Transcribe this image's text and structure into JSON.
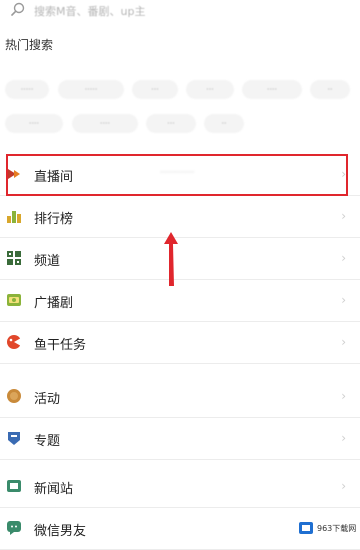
{
  "search": {
    "placeholder": "搜索M音、番剧、up主"
  },
  "hot_search": {
    "title": "热门搜索",
    "chips": [
      "·····",
      "·····",
      "···",
      "···",
      "····",
      "··",
      "····",
      "····",
      "···",
      "··"
    ]
  },
  "menu": {
    "items": [
      {
        "label": "直播间",
        "sub": "············",
        "icon": "live-icon"
      },
      {
        "label": "排行榜",
        "icon": "ranking-icon"
      },
      {
        "label": "频道",
        "icon": "channel-icon"
      },
      {
        "label": "广播剧",
        "icon": "radio-drama-icon"
      },
      {
        "label": "鱼干任务",
        "icon": "fish-task-icon"
      },
      {
        "label": "活动",
        "icon": "activity-icon"
      },
      {
        "label": "专题",
        "icon": "topic-icon"
      },
      {
        "label": "新闻站",
        "icon": "news-icon"
      },
      {
        "label": "微信男友",
        "icon": "wechat-boyfriend-icon"
      }
    ]
  },
  "annotation": {
    "box_color": "#e0262d",
    "arrow_color": "#e0262d"
  },
  "watermark": {
    "text": "963下载网"
  }
}
